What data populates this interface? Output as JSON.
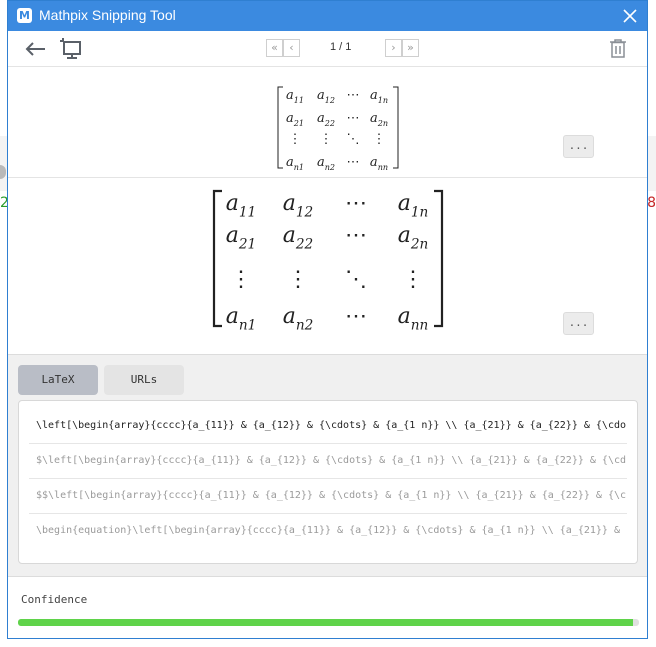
{
  "window": {
    "title": "Mathpix Snipping Tool",
    "accent_color": "#3b8ae0"
  },
  "toolbar": {
    "back_icon": "arrow-left-icon",
    "crop_icon": "crop-screen-icon",
    "pager": {
      "first_icon": "double-chevron-left-icon",
      "prev_icon": "chevron-left-icon",
      "page_label": "1 / 1",
      "next_icon": "chevron-right-icon",
      "last_icon": "double-chevron-right-icon"
    },
    "delete_icon": "trash-icon"
  },
  "preview": {
    "matrix": [
      [
        "a",
        "11",
        "a",
        "12",
        "⋯",
        "",
        "a",
        "1n"
      ],
      [
        "a",
        "21",
        "a",
        "22",
        "⋯",
        "",
        "a",
        "2n"
      ],
      [
        "⋮",
        "",
        "⋮",
        "",
        "⋱",
        "",
        "⋮",
        ""
      ],
      [
        "a",
        "n1",
        "a",
        "n2",
        "⋯",
        "",
        "a",
        "nn"
      ]
    ],
    "more_label": "..."
  },
  "tabs": [
    {
      "label": "LaTeX",
      "active": true
    },
    {
      "label": "URLs",
      "active": false
    }
  ],
  "latex_outputs": [
    "\\left[\\begin{array}{cccc}{a_{11}} & {a_{12}} & {\\cdots} & {a_{1 n}} \\\\ {a_{21}} & {a_{22}} & {\\cdo",
    "$\\left[\\begin{array}{cccc}{a_{11}} & {a_{12}} & {\\cdots} & {a_{1 n}} \\\\ {a_{21}} & {a_{22}} & {\\cd",
    "$$\\left[\\begin{array}{cccc}{a_{11}} & {a_{12}} & {\\cdots} & {a_{1 n}} \\\\ {a_{21}} & {a_{22}} & {\\c",
    "\\begin{equation}\\left[\\begin{array}{cccc}{a_{11}} & {a_{12}} & {\\cdots} & {a_{1 n}} \\\\ {a_{21}} &"
  ],
  "confidence": {
    "label": "Confidence",
    "value": 0.99,
    "color": "#5fd34a"
  }
}
